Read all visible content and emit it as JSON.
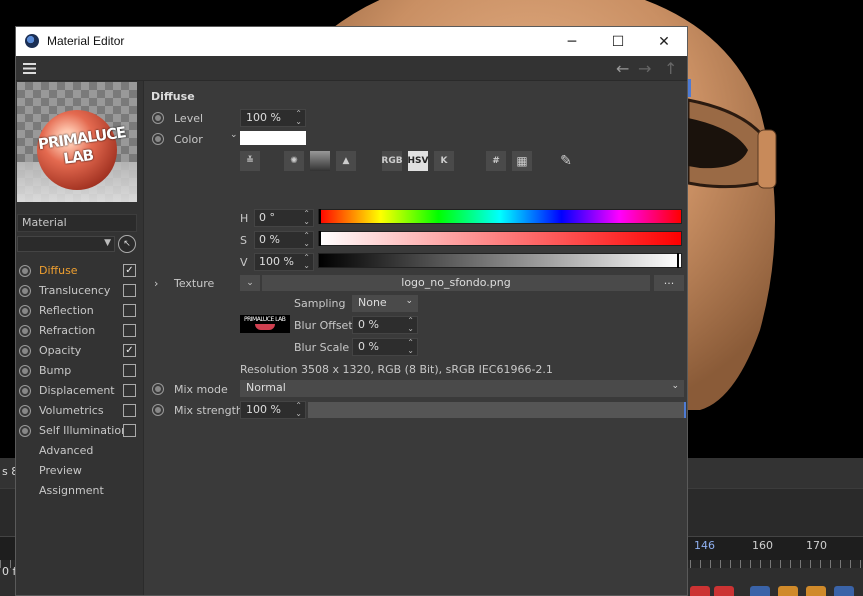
{
  "window": {
    "title": "Material Editor",
    "controls": {
      "minimize": "─",
      "maximize": "☐",
      "close": "✕"
    }
  },
  "menubar": {
    "menu_icon": "hamburger-icon",
    "back": "←",
    "forward": "→",
    "up": "↑"
  },
  "left": {
    "preview_label": "PRIMALUCE LAB",
    "material_name": "Material",
    "channels": [
      {
        "label": "Diffuse",
        "active": true,
        "checked": true,
        "has_check": true,
        "has_radio": true
      },
      {
        "label": "Translucency",
        "checked": false,
        "has_check": true,
        "has_radio": true
      },
      {
        "label": "Reflection",
        "checked": false,
        "has_check": true,
        "has_radio": true
      },
      {
        "label": "Refraction",
        "checked": false,
        "has_check": true,
        "has_radio": true
      },
      {
        "label": "Opacity",
        "checked": true,
        "has_check": true,
        "has_radio": true
      },
      {
        "label": "Bump",
        "checked": false,
        "has_check": true,
        "has_radio": true
      },
      {
        "label": "Displacement",
        "checked": false,
        "has_check": true,
        "has_radio": true
      },
      {
        "label": "Volumetrics",
        "checked": false,
        "has_check": true,
        "has_radio": true
      },
      {
        "label": "Self Illumination",
        "checked": false,
        "has_check": true,
        "has_radio": true
      },
      {
        "label": "Advanced",
        "has_check": false,
        "has_radio": false
      },
      {
        "label": "Preview",
        "has_check": false,
        "has_radio": false
      },
      {
        "label": "Assignment",
        "has_check": false,
        "has_radio": false
      }
    ],
    "check_mark": "✓"
  },
  "main": {
    "section": "Diffuse",
    "level": {
      "label": "Level",
      "value": "100 %"
    },
    "color": {
      "label": "Color",
      "swatch": "#ffffff",
      "tools": [
        "RGB",
        "HSV",
        "K",
        "#"
      ],
      "h": {
        "label": "H",
        "value": "0 °",
        "fraction": 0.0
      },
      "s": {
        "label": "S",
        "value": "0 %",
        "fraction": 0.0
      },
      "v": {
        "label": "V",
        "value": "100 %",
        "fraction": 1.0
      }
    },
    "texture": {
      "label": "Texture",
      "file": "logo_no_sfondo.png",
      "more": "...",
      "sampling_label": "Sampling",
      "sampling_value": "None",
      "blur_offset_label": "Blur Offset",
      "blur_offset_value": "0 %",
      "blur_scale_label": "Blur Scale",
      "blur_scale_value": "0 %",
      "thumb_text": "PRIMALUCE LAB",
      "resolution": "Resolution 3508 x 1320, RGB (8 Bit), sRGB IEC61966-2.1"
    },
    "mix_mode": {
      "label": "Mix mode",
      "value": "Normal"
    },
    "mix_strength": {
      "label": "Mix strength",
      "value": "100 %",
      "fraction": 1.0
    }
  },
  "timeline": {
    "labels": [
      "160",
      "170"
    ],
    "current_frame": "146",
    "left_text_1": "s 8/",
    "left_text_2": "0 f"
  },
  "colors": {
    "accent": "#f0a030",
    "frame_marker": "#4e7bd4"
  }
}
